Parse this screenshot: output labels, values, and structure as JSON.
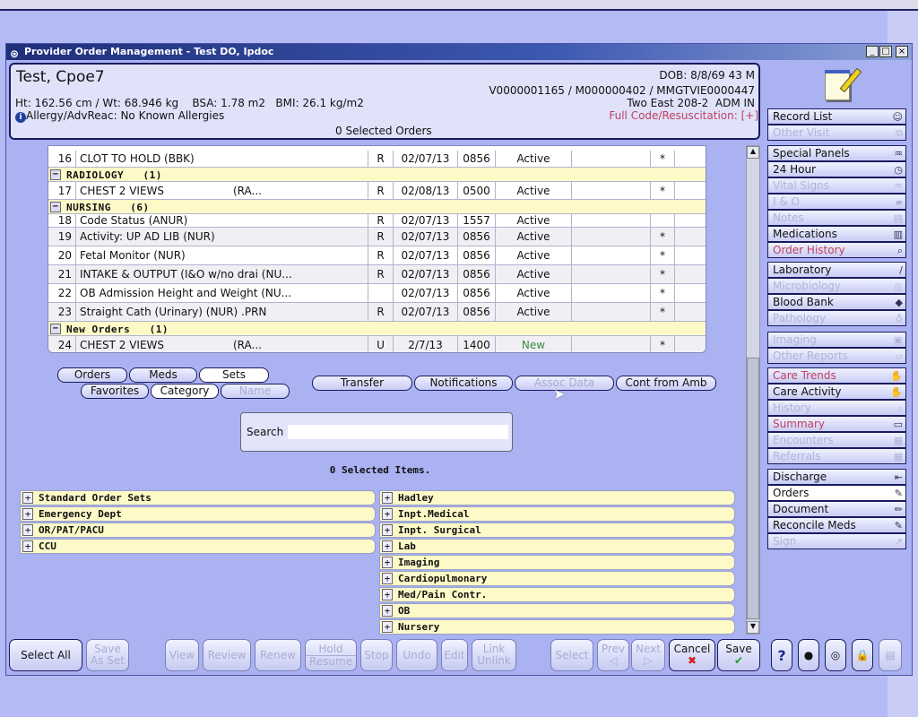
{
  "window": {
    "title": "Provider Order Management - Test DO, Ipdoc",
    "controls": [
      "_",
      "□",
      "×"
    ]
  },
  "patient": {
    "name": "Test, Cpoe7",
    "measures": "Ht: 162.56 cm / Wt: 68.946 kg    BSA: 1.78 m2   BMI: 26.1 kg/m2",
    "allergy": "Allergy/AdvReac: No Known Allergies",
    "dob": "DOB: 8/8/69 43 M",
    "ids": "V0000001165 / M000000402 / MMGTVIE0000447",
    "location": "Two East 208-2  ADM IN",
    "code_status": "Full Code/Resuscitation: [+]",
    "selected_orders": "0 Selected Orders"
  },
  "orders": [
    {
      "type": "row",
      "num": "16",
      "name": "CLOT TO HOLD (BBK)",
      "src": "",
      "flag": "R",
      "date": "02/07/13",
      "time": "0856",
      "status": "Active",
      "star": "*"
    },
    {
      "type": "group",
      "label": "RADIOLOGY   (1)"
    },
    {
      "type": "row",
      "num": "17",
      "name": "CHEST 2 VIEWS",
      "src": "(RA...",
      "flag": "R",
      "date": "02/08/13",
      "time": "0500",
      "status": "Active",
      "star": "*"
    },
    {
      "type": "group",
      "label": "NURSING   (6)"
    },
    {
      "type": "row",
      "num": "18",
      "name": "Code Status (ANUR)",
      "src": "",
      "flag": "R",
      "date": "02/07/13",
      "time": "1557",
      "status": "Active",
      "star": ""
    },
    {
      "type": "row",
      "num": "19",
      "name": "Activity: UP AD LIB (NUR)",
      "src": "",
      "flag": "R",
      "date": "02/07/13",
      "time": "0856",
      "status": "Active",
      "star": "*"
    },
    {
      "type": "row",
      "num": "20",
      "name": "Fetal Monitor (NUR)",
      "src": "",
      "flag": "R",
      "date": "02/07/13",
      "time": "0856",
      "status": "Active",
      "star": "*"
    },
    {
      "type": "row",
      "num": "21",
      "name": "INTAKE & OUTPUT (I&O w/no drai (NU...",
      "src": "",
      "flag": "R",
      "date": "02/07/13",
      "time": "0856",
      "status": "Active",
      "star": "*"
    },
    {
      "type": "row",
      "num": "22",
      "name": "OB Admission Height and Weight (NU...",
      "src": "",
      "flag": "",
      "date": "02/07/13",
      "time": "0856",
      "status": "Active",
      "star": "*"
    },
    {
      "type": "row",
      "num": "23",
      "name": "Straight Cath (Urinary) (NUR) .PRN",
      "src": "",
      "flag": "R",
      "date": "02/07/13",
      "time": "0856",
      "status": "Active",
      "star": "*"
    },
    {
      "type": "group",
      "label": "New Orders   (1)"
    },
    {
      "type": "row",
      "num": "24",
      "name": "CHEST 2 VIEWS",
      "src": "(RA...",
      "flag": "U",
      "date": "2/7/13",
      "time": "1400",
      "status": "New",
      "star": "*"
    }
  ],
  "tabs": {
    "orders": "Orders",
    "meds": "Meds",
    "sets": "Sets",
    "favorites": "Favorites",
    "category": "Category",
    "name": "Name"
  },
  "actions": {
    "transfer": "Transfer",
    "notifications": "Notifications",
    "assoc_data": "Assoc Data",
    "cont_from_amb": "Cont from Amb"
  },
  "search": {
    "label": "Search",
    "value": ""
  },
  "selected_items": "0 Selected Items.",
  "categories_left": [
    "Standard Order Sets",
    "Emergency Dept",
    "OR/PAT/PACU",
    "CCU"
  ],
  "categories_right": [
    "Hadley",
    "Inpt.Medical",
    "Inpt. Surgical",
    "Lab",
    "Imaging",
    "Cardiopulmonary",
    "Med/Pain Contr.",
    "OB",
    "Nursery"
  ],
  "sidebar": [
    {
      "label": "Record List",
      "state": "normal",
      "icon": "person-icon"
    },
    {
      "label": "Other Visit",
      "state": "disabled",
      "icon": "windows-icon"
    },
    {
      "label": "Special Panels",
      "state": "normal",
      "icon": "pulse-folder-icon"
    },
    {
      "label": "24 Hour",
      "state": "normal",
      "icon": "clock-icon"
    },
    {
      "label": "Vital Signs",
      "state": "disabled",
      "icon": "pulse-folder-icon"
    },
    {
      "label": "I & O",
      "state": "disabled",
      "icon": "drop-folder-icon"
    },
    {
      "label": "Notes",
      "state": "disabled",
      "icon": "notes-icon"
    },
    {
      "label": "Medications",
      "state": "normal",
      "icon": "medications-icon"
    },
    {
      "label": "Order History",
      "state": "red",
      "icon": "search-folder-icon"
    },
    {
      "label": "Laboratory",
      "state": "normal",
      "icon": "test-tube-icon"
    },
    {
      "label": "Microbiology",
      "state": "disabled",
      "icon": "petri-icon"
    },
    {
      "label": "Blood Bank",
      "state": "normal",
      "icon": "blood-bag-icon"
    },
    {
      "label": "Pathology",
      "state": "disabled",
      "icon": "microscope-icon"
    },
    {
      "label": "Imaging",
      "state": "disabled",
      "icon": "image-icon"
    },
    {
      "label": "Other Reports",
      "state": "disabled",
      "icon": "report-icon"
    },
    {
      "label": "Care Trends",
      "state": "red",
      "icon": "care-icon"
    },
    {
      "label": "Care Activity",
      "state": "normal",
      "icon": "care-icon"
    },
    {
      "label": "History",
      "state": "disabled",
      "icon": "search-folder-icon"
    },
    {
      "label": "Summary",
      "state": "red",
      "icon": "folder-icon"
    },
    {
      "label": "Encounters",
      "state": "disabled",
      "icon": "encounter-icon"
    },
    {
      "label": "Referrals",
      "state": "disabled",
      "icon": "grid-icon"
    },
    {
      "label": "Discharge",
      "state": "normal",
      "icon": "discharge-icon"
    },
    {
      "label": "Orders",
      "state": "selected",
      "icon": "order-pad-icon"
    },
    {
      "label": "Document",
      "state": "normal",
      "icon": "pencil-icon"
    },
    {
      "label": "Reconcile Meds",
      "state": "normal",
      "icon": "order-pad-icon"
    },
    {
      "label": "Sign",
      "state": "disabled",
      "icon": "sign-icon"
    }
  ],
  "toolbar": [
    {
      "l1": "Select All",
      "l2": "",
      "state": "normal"
    },
    {
      "l1": "Save",
      "l2": "As Set",
      "state": "disabled"
    },
    {
      "l1": "View",
      "l2": "",
      "state": "disabled"
    },
    {
      "l1": "Review",
      "l2": "",
      "state": "disabled"
    },
    {
      "l1": "Renew",
      "l2": "",
      "state": "disabled"
    },
    {
      "l1": "Hold",
      "l2": "Resume",
      "state": "disabled"
    },
    {
      "l1": "Stop",
      "l2": "",
      "state": "disabled"
    },
    {
      "l1": "Undo",
      "l2": "",
      "state": "disabled"
    },
    {
      "l1": "Edit",
      "l2": "",
      "state": "disabled"
    },
    {
      "l1": "Link",
      "l2": "Unlink",
      "state": "disabled"
    },
    {
      "l1": "Select",
      "l2": "",
      "state": "disabled"
    },
    {
      "l1": "Prev",
      "l2": "◁",
      "state": "disabled"
    },
    {
      "l1": "Next",
      "l2": "▷",
      "state": "disabled"
    },
    {
      "l1": "Cancel",
      "l2": "✖",
      "state": "normal"
    },
    {
      "l1": "Save",
      "l2": "✔",
      "state": "normal"
    },
    {
      "l1": "?",
      "l2": "",
      "state": "normal"
    },
    {
      "l1": "●",
      "l2": "",
      "state": "normal"
    },
    {
      "l1": "◎",
      "l2": "",
      "state": "normal"
    },
    {
      "l1": "🔒",
      "l2": "",
      "state": "normal"
    },
    {
      "l1": "▤",
      "l2": "",
      "state": "disabled"
    }
  ],
  "colors": {
    "window_bg": "#aab2f2",
    "title_bar": "#1f2f7a",
    "group_row": "#fdfac8",
    "alert_red": "#c04060",
    "new_status": "#3a8a3a"
  }
}
